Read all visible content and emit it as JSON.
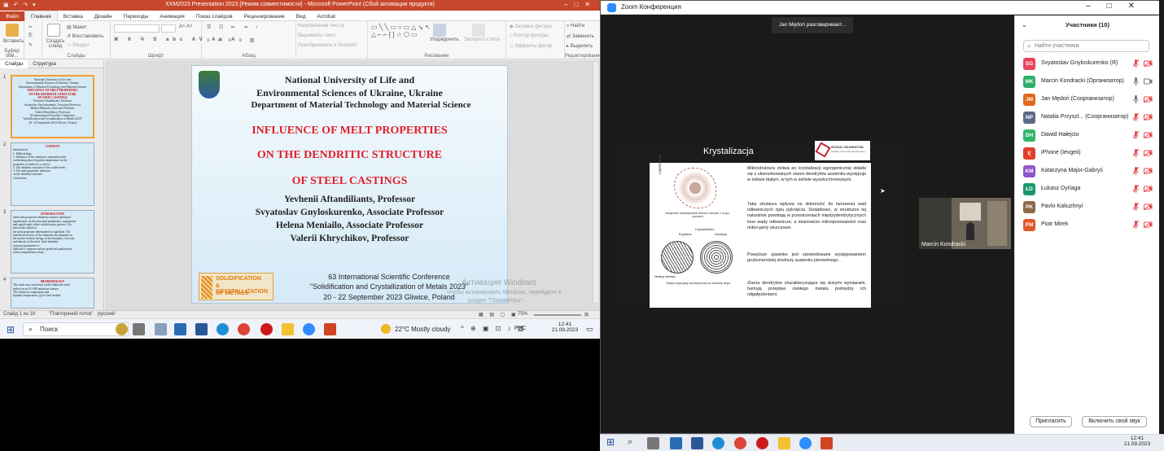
{
  "ppt": {
    "title": "ХХМ2023 Presentation 2023 [Режим совместимости] - Microsoft PowerPoint (Сбой активации продукта)",
    "tabs": [
      "Файл",
      "Главная",
      "Вставка",
      "Дизайн",
      "Переходы",
      "Анимация",
      "Показ слайдов",
      "Рецензирование",
      "Вид",
      "Acrobat"
    ],
    "ribbon": {
      "paste": "Вставить",
      "clipboard": "Буфер обм...",
      "create_slide": "Создать слайд",
      "layout": "Макет",
      "reset": "Восстановить",
      "section": "Раздел",
      "slides_group": "Слайды",
      "font_group": "Шрифт",
      "para_group": "Абзац",
      "text_dir": "Направление текста",
      "align_text": "Выровнять текст",
      "smartart": "Преобразовать в SmartArt",
      "arrange": "Упорядочить",
      "quick_styles": "Экспресс-стили",
      "drawing_group": "Рисование",
      "fill": "Заливка фигуры",
      "outline": "Контур фигуры",
      "effects": "Эффекты фигур",
      "find": "Найти",
      "replace": "Заменить",
      "select": "Выделить",
      "editing_group": "Редактирование"
    },
    "pane_tabs": [
      "Слайды",
      "Структура"
    ],
    "thumbs": [
      {
        "num": "1",
        "lines": [
          "National University of Life and",
          "Environmental Sciences of Ukraine, Ukraine",
          "Department of Material Technology and Material Science"
        ],
        "red": [
          "INFLUENCE OF MELT PROPERTIES",
          "ON THE DENDRITIC STRUCTURE",
          "OF STEEL CASTINGS"
        ],
        "names": [
          "Yevhenii Aftandiliants, Professor",
          "Svyatoslav Gnyloskurenko, Associate Professor",
          "Helena Meniailo, Associate Professor",
          "Valerii Khrychikov, Professor"
        ],
        "conf": [
          "63 International Scientific Conference",
          "\"Solidification and Crystallization of Metals 2023\"",
          "20 - 22 September 2023 Gliwice, Poland"
        ]
      },
      {
        "num": "2",
        "head": "CONTENT",
        "lines": [
          "Introduction",
          "1. Methodology",
          "2. Influence of the chemical composition and",
          "overheating above liquidus temperature on the",
          "properties of melts (cr, ρ and σ)",
          "3. The dendritic structure of the cooled steels",
          "4. The melt properties influence",
          "on the dendritic structure",
          "Conclusion"
        ]
      },
      {
        "num": "3",
        "head": "INTRODUCTION",
        "lines": [
          "Steel melt properties influence surface and liquid",
          "significantly on the structural parameters, segregation",
          "and significantly affect solidification process. It is",
          "known the effects of",
          "the melt properties determined by superheat. The",
          "interfacial activity of the elements also depends on",
          "the surface tension energy of the boundary, viscosity",
          "and density of the melt. Steel dendritic",
          "structure parameters is",
          "difficult to compare and are predicted qualitatively",
          "when comprehensive data."
        ]
      },
      {
        "num": "4",
        "head": "METHODOLOGY",
        "lines": [
          "The study was carried out on the industrial steels",
          "melted in an 10 t HF induction furnace",
          "The chemical composition and",
          "liquidus temperature, (p) of steel studied"
        ]
      }
    ],
    "slide": {
      "l1": "National University of Life and",
      "l2": "Environmental Sciences of Ukraine, Ukraine",
      "l3": "Department of Material Technology and Material Science",
      "r1": "INFLUENCE OF MELT PROPERTIES",
      "r2": "ON THE DENDRITIC STRUCTURE",
      "r3": "OF STEEL CASTINGS",
      "a1": "Yevhenii Aftandiliants, Professor",
      "a2": "Svyatoslav Gnyloskurenko, Associate Professor",
      "a3": "Helena Meniailo, Associate Professor",
      "a4": "Valerii Khrychikov, Professor",
      "c1": "63 International Scientific Conference",
      "c2": "\"Solidification and Crystallization of Metals 2023\"",
      "c3": "20 - 22 September 2023 Gliwice, Poland",
      "logo_l1": "SOLIDIFICATION",
      "logo_l2": "& CRYSTALLIZATION",
      "logo_l3": "OF METALS",
      "wm1": "Активация Windows",
      "wm2": "Чтобы активировать Windows, перейдите в",
      "wm3": "раздел \"Параметры\"."
    },
    "status": {
      "slide": "Слайд 1 из 19",
      "theme": "\"Повторений поток\"",
      "lang": "русский",
      "zoom": "75%"
    }
  },
  "left_taskbar": {
    "search": "Поиск",
    "weather": "22°C  Mostly cloudy",
    "lang": "РУС",
    "time": "12:41",
    "date": "21.09.2023"
  },
  "zoom": {
    "title": "Zoom Конференция",
    "banner": "Jan Mędoń разговаривает...",
    "share_title": "Krystalizacja",
    "logo_text": "WYDZIAŁ ODLEWNICTWA",
    "logo_sub": "Faculty of Foundry Engineering",
    "fig_top_label": "Liquid metal",
    "fig_caption": "Wzajemne oddziaływanie ziarnem wzrostu z rozpo-ziarnami",
    "fig_labels": [
      "Equiaxes",
      "Crystallization",
      "Dendryty"
    ],
    "fig_bottom_label": "Heating direction",
    "fig_caption2": "Wpływ segregacji dendrytycznej na strukturę stopu",
    "paragraphs": [
      "Mikrostruktura żeliwa po krystalizacji egzogenicznej składa się z ukierunkowanych ziaren dendrytów austenitu-wysiępuje w żeliwie białym, w tym w żeliwie wysokochromowym.",
      "Taka struktura wpływa na skłonność do tworzenia wad odlewniczych typu pęknięcia. Dodatkowo, w strukturze tej naturalnie powstają w przestrzeniach międzydendrytycznych inne wady odlewnicze, a mianowicie mikroporowatości oraz mikro-jamy skurczowe.",
      "Powyższe zjawisko jest spowodowane występowaniem gruboziarnistej struktury austenitu pierwotnego.",
      "Ziarna dendrytów charakteryzujące się dużymi wymiarami, hamują przepływ ciekłego metalu pomiędzy ich odgałęzieniami."
    ],
    "self_name": "Marcin Kondracki",
    "panel_title": "Участники (10)",
    "search_placeholder": "Найти участника",
    "participants": [
      {
        "initials": "SG",
        "name": "Svyatoslav Gnyloskurenko (Я)",
        "color": "#e8445a",
        "mic": "off",
        "cam": "off"
      },
      {
        "initials": "MK",
        "name": "Marcin Kondracki (Организатор)",
        "color": "#2fae6a",
        "mic": "on",
        "cam": "on"
      },
      {
        "initials": "JM",
        "name": "Jan Mędoń (Соорганизатор)",
        "color": "#e06a1c",
        "mic": "on",
        "cam": "off"
      },
      {
        "initials": "NP",
        "name": "Natalia Przyszl... (Соорганизатор)",
        "color": "#5a6b85",
        "mic": "off",
        "cam": "off"
      },
      {
        "initials": "DH",
        "name": "Dawid Hałejcio",
        "color": "#33b56b",
        "mic": "off",
        "cam": "off"
      },
      {
        "initials": "I(",
        "name": "iPhone (Ievgeii)",
        "color": "#e03f2e",
        "mic": "off",
        "cam": "off"
      },
      {
        "initials": "KM",
        "name": "Katarzyna Major-Gabryś",
        "color": "#8e58c8",
        "mic": "off",
        "cam": "off"
      },
      {
        "initials": "ŁD",
        "name": "Łukasz Dyrlaga",
        "color": "#1a9a6c",
        "mic": "off",
        "cam": "off"
      },
      {
        "initials": "PK",
        "name": "Pavlo Kaliuzhnyi",
        "color": "#8b6a4a",
        "mic": "off",
        "cam": "off"
      },
      {
        "initials": "PM",
        "name": "Piotr Mirek",
        "color": "#e0582a",
        "mic": "off",
        "cam": "off"
      }
    ],
    "invite": "Пригласить",
    "unmute": "Включить свой звук"
  },
  "right_taskbar": {
    "time": "12:41",
    "date": "21.09.2023"
  }
}
